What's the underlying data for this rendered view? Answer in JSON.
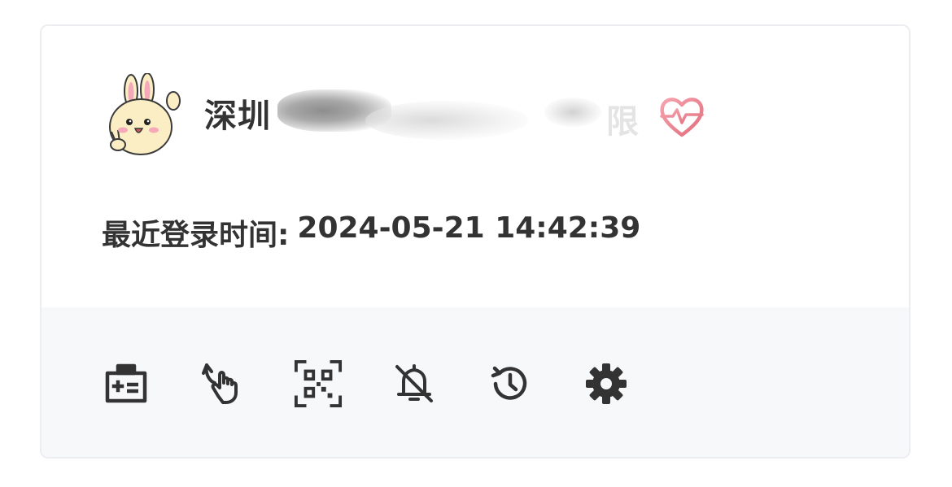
{
  "profile": {
    "name_visible": "深圳",
    "name_tail": "限",
    "avatar_icon": "bunny-avatar-icon",
    "badge_icon": "heart-pulse-icon",
    "badge_color": "#e9818c"
  },
  "login": {
    "label": "最近登录时间:",
    "value": "2024-05-21 14:42:39"
  },
  "toolbar": {
    "icons": [
      "id-card-icon",
      "tap-gesture-icon",
      "qr-scan-icon",
      "bell-off-icon",
      "history-icon",
      "settings-icon"
    ],
    "icon_color": "#333333"
  },
  "colors": {
    "card_border": "#ecedf0",
    "footer_bg": "#f7f8fa",
    "text": "#333333"
  }
}
